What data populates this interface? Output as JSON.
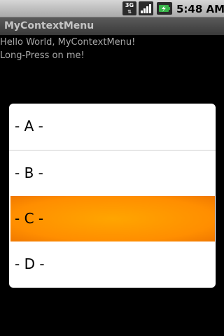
{
  "status_bar": {
    "network_label": "3G",
    "time": "5:48 AM"
  },
  "app": {
    "title": "MyContextMenu"
  },
  "content": {
    "lines": [
      "Hello World, MyContextMenu!",
      "Long-Press on me!"
    ]
  },
  "context_menu": {
    "items": [
      {
        "label": "- A -",
        "selected": false
      },
      {
        "label": "- B -",
        "selected": false
      },
      {
        "label": "- C -",
        "selected": true
      },
      {
        "label": "- D -",
        "selected": false
      }
    ]
  },
  "colors": {
    "highlight": "#ff9900",
    "background": "#000000",
    "menu_background": "#ffffff"
  }
}
